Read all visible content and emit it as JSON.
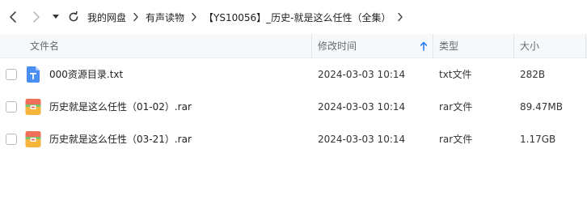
{
  "nav": {
    "back_icon": "chevron-left-icon",
    "forward_icon": "chevron-right-icon",
    "dropdown_icon": "caret-down-icon",
    "refresh_icon": "refresh-icon"
  },
  "breadcrumb": {
    "items": [
      "我的网盘",
      "有声读物",
      "【YS10056】_历史-就是这么任性（全集）"
    ],
    "separator_icon": "chevron-right-icon"
  },
  "table": {
    "columns": {
      "name": "文件名",
      "modified": "修改时间",
      "type": "类型",
      "size": "大小"
    },
    "sort_icon": "arrow-up-icon",
    "rows": [
      {
        "name": "000资源目录.txt",
        "modified": "2024-03-03 10:14",
        "type": "txt文件",
        "size": "282B",
        "icon": "txt-file-icon"
      },
      {
        "name": "历史就是这么任性（01-02）.rar",
        "modified": "2024-03-03 10:14",
        "type": "rar文件",
        "size": "89.47MB",
        "icon": "rar-archive-icon"
      },
      {
        "name": "历史就是这么任性（03-21）.rar",
        "modified": "2024-03-03 10:14",
        "type": "rar文件",
        "size": "1.17GB",
        "icon": "rar-archive-icon"
      }
    ]
  },
  "colors": {
    "accent": "#2f7cf6",
    "header_bg": "#f7f8fa",
    "txt_icon": "#4a8ef5",
    "rar_icon_top": "#f06e5a",
    "rar_icon_bottom": "#f5b53d",
    "rar_icon_strip": "#7dc26a"
  }
}
